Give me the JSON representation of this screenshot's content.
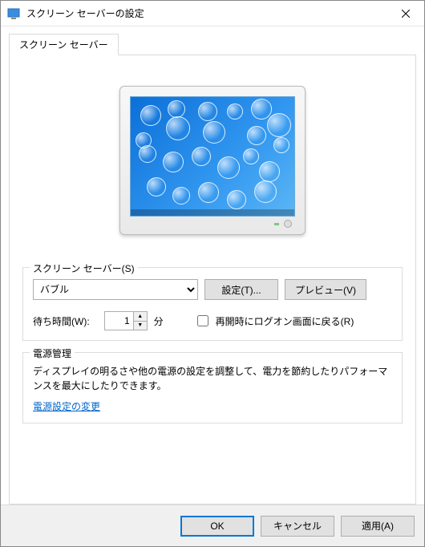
{
  "window": {
    "title": "スクリーン セーバーの設定"
  },
  "tab": {
    "label": "スクリーン セーバー"
  },
  "screensaver_group": {
    "title": "スクリーン セーバー(S)",
    "selected": "バブル",
    "settings_btn": "設定(T)...",
    "preview_btn": "プレビュー(V)",
    "wait_label": "待ち時間(W):",
    "wait_value": "1",
    "wait_unit": "分",
    "resume_checkbox": "再開時にログオン画面に戻る(R)",
    "resume_checked": false
  },
  "power_group": {
    "title": "電源管理",
    "description": "ディスプレイの明るさや他の電源の設定を調整して、電力を節約したりパフォーマンスを最大にしたりできます。",
    "link": "電源設定の変更"
  },
  "buttons": {
    "ok": "OK",
    "cancel": "キャンセル",
    "apply": "適用(A)"
  }
}
